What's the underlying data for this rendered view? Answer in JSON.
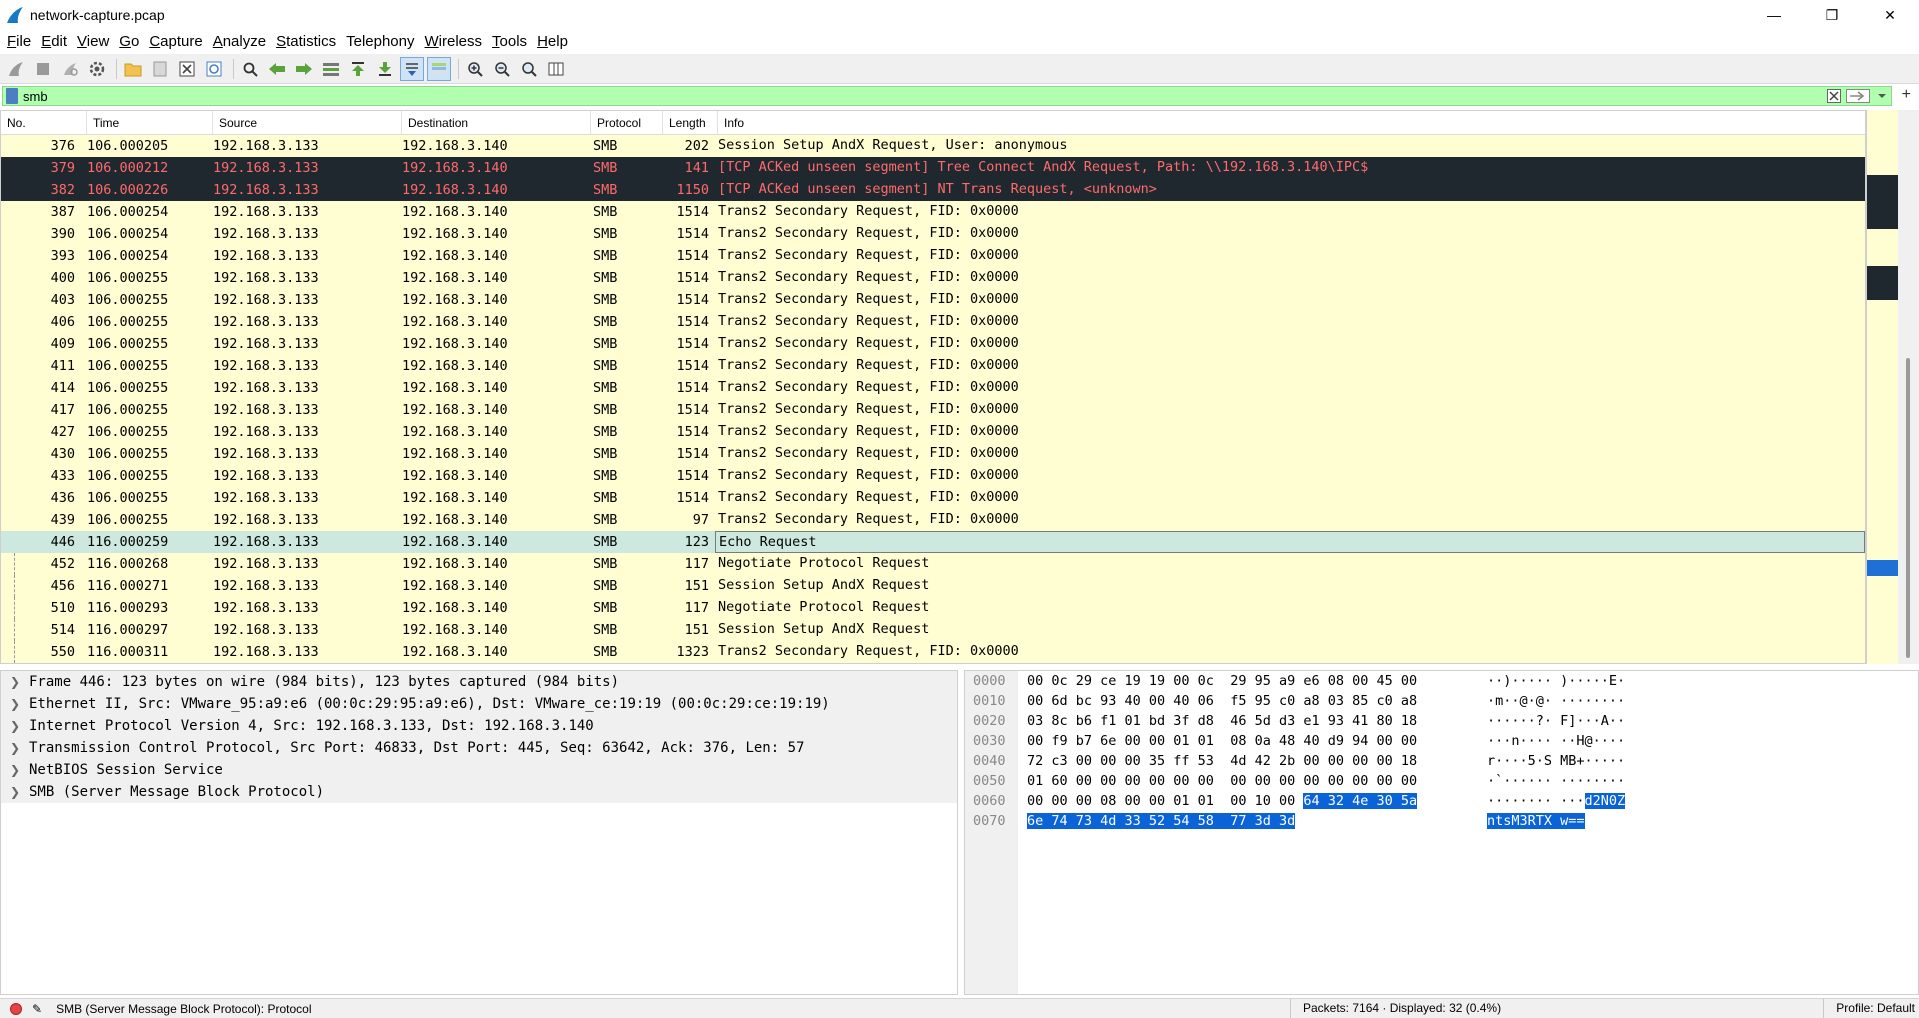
{
  "window": {
    "title": "network-capture.pcap",
    "minimize": "—",
    "maximize": "❐",
    "close": "✕"
  },
  "menu": [
    {
      "label": "File",
      "u": "F",
      "rest": "ile"
    },
    {
      "label": "Edit",
      "u": "E",
      "rest": "dit"
    },
    {
      "label": "View",
      "u": "V",
      "rest": "iew"
    },
    {
      "label": "Go",
      "u": "G",
      "rest": "o"
    },
    {
      "label": "Capture",
      "u": "C",
      "rest": "apture"
    },
    {
      "label": "Analyze",
      "u": "A",
      "rest": "nalyze"
    },
    {
      "label": "Statistics",
      "u": "S",
      "rest": "tatistics"
    },
    {
      "label": "Telephony",
      "u": "",
      "rest": "Telephony"
    },
    {
      "label": "Wireless",
      "u": "W",
      "rest": "ireless"
    },
    {
      "label": "Tools",
      "u": "T",
      "rest": "ools"
    },
    {
      "label": "Help",
      "u": "H",
      "rest": "elp"
    }
  ],
  "filter": {
    "value": "smb"
  },
  "columns": {
    "no": "No.",
    "time": "Time",
    "source": "Source",
    "destination": "Destination",
    "protocol": "Protocol",
    "length": "Length",
    "info": "Info"
  },
  "packets": [
    {
      "no": "376",
      "time": "106.000205",
      "src": "192.168.3.133",
      "dst": "192.168.3.140",
      "proto": "SMB",
      "len": "202",
      "info": "Session Setup AndX Request, User: anonymous",
      "style": "normal"
    },
    {
      "no": "379",
      "time": "106.000212",
      "src": "192.168.3.133",
      "dst": "192.168.3.140",
      "proto": "SMB",
      "len": "141",
      "info": "[TCP ACKed unseen segment] Tree Connect AndX Request, Path: \\\\192.168.3.140\\IPC$",
      "style": "dark"
    },
    {
      "no": "382",
      "time": "106.000226",
      "src": "192.168.3.133",
      "dst": "192.168.3.140",
      "proto": "SMB",
      "len": "1150",
      "info": "[TCP ACKed unseen segment] NT Trans Request, <unknown>",
      "style": "dark"
    },
    {
      "no": "387",
      "time": "106.000254",
      "src": "192.168.3.133",
      "dst": "192.168.3.140",
      "proto": "SMB",
      "len": "1514",
      "info": "Trans2 Secondary Request, FID: 0x0000",
      "style": "normal"
    },
    {
      "no": "390",
      "time": "106.000254",
      "src": "192.168.3.133",
      "dst": "192.168.3.140",
      "proto": "SMB",
      "len": "1514",
      "info": "Trans2 Secondary Request, FID: 0x0000",
      "style": "normal"
    },
    {
      "no": "393",
      "time": "106.000254",
      "src": "192.168.3.133",
      "dst": "192.168.3.140",
      "proto": "SMB",
      "len": "1514",
      "info": "Trans2 Secondary Request, FID: 0x0000",
      "style": "normal"
    },
    {
      "no": "400",
      "time": "106.000255",
      "src": "192.168.3.133",
      "dst": "192.168.3.140",
      "proto": "SMB",
      "len": "1514",
      "info": "Trans2 Secondary Request, FID: 0x0000",
      "style": "normal"
    },
    {
      "no": "403",
      "time": "106.000255",
      "src": "192.168.3.133",
      "dst": "192.168.3.140",
      "proto": "SMB",
      "len": "1514",
      "info": "Trans2 Secondary Request, FID: 0x0000",
      "style": "normal"
    },
    {
      "no": "406",
      "time": "106.000255",
      "src": "192.168.3.133",
      "dst": "192.168.3.140",
      "proto": "SMB",
      "len": "1514",
      "info": "Trans2 Secondary Request, FID: 0x0000",
      "style": "normal"
    },
    {
      "no": "409",
      "time": "106.000255",
      "src": "192.168.3.133",
      "dst": "192.168.3.140",
      "proto": "SMB",
      "len": "1514",
      "info": "Trans2 Secondary Request, FID: 0x0000",
      "style": "normal"
    },
    {
      "no": "411",
      "time": "106.000255",
      "src": "192.168.3.133",
      "dst": "192.168.3.140",
      "proto": "SMB",
      "len": "1514",
      "info": "Trans2 Secondary Request, FID: 0x0000",
      "style": "normal"
    },
    {
      "no": "414",
      "time": "106.000255",
      "src": "192.168.3.133",
      "dst": "192.168.3.140",
      "proto": "SMB",
      "len": "1514",
      "info": "Trans2 Secondary Request, FID: 0x0000",
      "style": "normal"
    },
    {
      "no": "417",
      "time": "106.000255",
      "src": "192.168.3.133",
      "dst": "192.168.3.140",
      "proto": "SMB",
      "len": "1514",
      "info": "Trans2 Secondary Request, FID: 0x0000",
      "style": "normal"
    },
    {
      "no": "427",
      "time": "106.000255",
      "src": "192.168.3.133",
      "dst": "192.168.3.140",
      "proto": "SMB",
      "len": "1514",
      "info": "Trans2 Secondary Request, FID: 0x0000",
      "style": "normal"
    },
    {
      "no": "430",
      "time": "106.000255",
      "src": "192.168.3.133",
      "dst": "192.168.3.140",
      "proto": "SMB",
      "len": "1514",
      "info": "Trans2 Secondary Request, FID: 0x0000",
      "style": "normal"
    },
    {
      "no": "433",
      "time": "106.000255",
      "src": "192.168.3.133",
      "dst": "192.168.3.140",
      "proto": "SMB",
      "len": "1514",
      "info": "Trans2 Secondary Request, FID: 0x0000",
      "style": "normal"
    },
    {
      "no": "436",
      "time": "106.000255",
      "src": "192.168.3.133",
      "dst": "192.168.3.140",
      "proto": "SMB",
      "len": "1514",
      "info": "Trans2 Secondary Request, FID: 0x0000",
      "style": "normal"
    },
    {
      "no": "439",
      "time": "106.000255",
      "src": "192.168.3.133",
      "dst": "192.168.3.140",
      "proto": "SMB",
      "len": "97",
      "info": "Trans2 Secondary Request, FID: 0x0000",
      "style": "normal"
    },
    {
      "no": "446",
      "time": "116.000259",
      "src": "192.168.3.133",
      "dst": "192.168.3.140",
      "proto": "SMB",
      "len": "123",
      "info": "Echo Request",
      "style": "selected"
    },
    {
      "no": "452",
      "time": "116.000268",
      "src": "192.168.3.133",
      "dst": "192.168.3.140",
      "proto": "SMB",
      "len": "117",
      "info": "Negotiate Protocol Request",
      "style": "normal"
    },
    {
      "no": "456",
      "time": "116.000271",
      "src": "192.168.3.133",
      "dst": "192.168.3.140",
      "proto": "SMB",
      "len": "151",
      "info": "Session Setup AndX Request",
      "style": "normal"
    },
    {
      "no": "510",
      "time": "116.000293",
      "src": "192.168.3.133",
      "dst": "192.168.3.140",
      "proto": "SMB",
      "len": "117",
      "info": "Negotiate Protocol Request",
      "style": "normal"
    },
    {
      "no": "514",
      "time": "116.000297",
      "src": "192.168.3.133",
      "dst": "192.168.3.140",
      "proto": "SMB",
      "len": "151",
      "info": "Session Setup AndX Request",
      "style": "normal"
    },
    {
      "no": "550",
      "time": "116.000311",
      "src": "192.168.3.133",
      "dst": "192.168.3.140",
      "proto": "SMB",
      "len": "1323",
      "info": "Trans2 Secondary Request, FID: 0x0000",
      "style": "normal"
    }
  ],
  "details": [
    "Frame 446: 123 bytes on wire (984 bits), 123 bytes captured (984 bits)",
    "Ethernet II, Src: VMware_95:a9:e6 (00:0c:29:95:a9:e6), Dst: VMware_ce:19:19 (00:0c:29:ce:19:19)",
    "Internet Protocol Version 4, Src: 192.168.3.133, Dst: 192.168.3.140",
    "Transmission Control Protocol, Src Port: 46833, Dst Port: 445, Seq: 63642, Ack: 376, Len: 57",
    "NetBIOS Session Service",
    "SMB (Server Message Block Protocol)"
  ],
  "bytes": [
    {
      "off": "0000",
      "hex": "00 0c 29 ce 19 19 00 0c  29 95 a9 e6 08 00 45 00",
      "ascii": "··)····· )·····E·"
    },
    {
      "off": "0010",
      "hex": "00 6d bc 93 40 00 40 06  f5 95 c0 a8 03 85 c0 a8",
      "ascii": "·m··@·@· ········"
    },
    {
      "off": "0020",
      "hex": "03 8c b6 f1 01 bd 3f d8  46 5d d3 e1 93 41 80 18",
      "ascii": "······?· F]···A··"
    },
    {
      "off": "0030",
      "hex": "00 f9 b7 6e 00 00 01 01  08 0a 48 40 d9 94 00 00",
      "ascii": "···n···· ··H@····"
    },
    {
      "off": "0040",
      "hex": "72 c3 00 00 00 35 ff 53  4d 42 2b 00 00 00 00 18",
      "ascii": "r····5·S MB+·····"
    },
    {
      "off": "0050",
      "hex": "01 60 00 00 00 00 00 00  00 00 00 00 00 00 00 00",
      "ascii": "·`······ ········"
    },
    {
      "off": "0060",
      "hex_a": "00 00 00 08 00 00 01 01  00 10 00 ",
      "hex_b": "64 32 4e 30 5a",
      "ascii_a": "········ ···",
      "ascii_b": "d2N0Z"
    },
    {
      "off": "0070",
      "hex_b": "6e 74 73 4d 33 52 54 58  77 3d 3d",
      "ascii_b": "ntsM3RTX w=="
    }
  ],
  "status": {
    "text": "SMB (Server Message Block Protocol): Protocol",
    "packets": "Packets: 7164 · Displayed: 32 (0.4%)",
    "profile": "Profile: Default"
  },
  "colors": {
    "row_normal": "#fffed2",
    "row_dark": "#1f272f",
    "row_dark_text": "#ff6b6b",
    "row_selected": "#cde8df",
    "filter_bg": "#afffaf",
    "hex_highlight": "#0a64d8"
  }
}
